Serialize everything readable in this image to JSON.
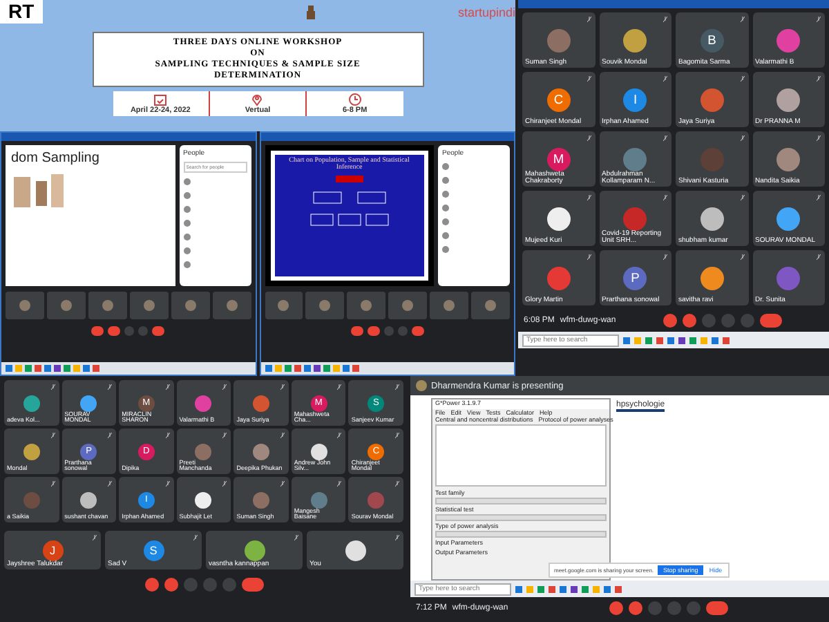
{
  "poster": {
    "logo": "RT",
    "brand": "startupindi",
    "title_lines": [
      "THREE DAYS ONLINE WORKSHOP",
      "ON",
      "SAMPLING TECHNIQUES & SAMPLE SIZE",
      "DETERMINATION"
    ],
    "info": [
      {
        "kind": "calendar",
        "text": "April 22-24, 2022"
      },
      {
        "kind": "pin",
        "text": "Vertual"
      },
      {
        "kind": "clock",
        "text": "6-8 PM"
      }
    ]
  },
  "left_window": {
    "slide_title": "dom Sampling",
    "people_title": "People",
    "search_placeholder": "Search for people"
  },
  "right_window": {
    "slide_title": "Chart on Population, Sample and Statistical Inference",
    "people_title": "People"
  },
  "top_grid": {
    "tiles": [
      {
        "name": "Suman Singh",
        "kind": "photo",
        "color": "#8d6e63"
      },
      {
        "name": "Souvik Mondal",
        "kind": "photo",
        "color": "#c0a040"
      },
      {
        "name": "Bagomita Sarma",
        "kind": "letter",
        "letter": "B",
        "color": "#455a64"
      },
      {
        "name": "Valarmathi B",
        "kind": "photo",
        "color": "#e040a0"
      },
      {
        "name": "Chiranjeet Mondal",
        "kind": "letter",
        "letter": "C",
        "color": "#ef6c00"
      },
      {
        "name": "Irphan Ahamed",
        "kind": "letter",
        "letter": "I",
        "color": "#1e88e5"
      },
      {
        "name": "Jaya Suriya",
        "kind": "photo",
        "color": "#d35430"
      },
      {
        "name": "Dr PRANNA M",
        "kind": "photo",
        "color": "#b0a0a0"
      },
      {
        "name": "Mahashweta Chakraborty",
        "kind": "letter",
        "letter": "M",
        "color": "#d81b60"
      },
      {
        "name": "Abdulrahman Kollamparam N...",
        "kind": "photo",
        "color": "#607d8b"
      },
      {
        "name": "Shivani Kasturia",
        "kind": "photo",
        "color": "#5d4037"
      },
      {
        "name": "Nandita Saikia",
        "kind": "photo",
        "color": "#a1887f"
      },
      {
        "name": "Mujeed Kuri",
        "kind": "photo",
        "color": "#eeeeee"
      },
      {
        "name": "Covid-19 Reporting Unit SRH...",
        "kind": "photo",
        "color": "#c62828"
      },
      {
        "name": "shubham kumar",
        "kind": "photo",
        "color": "#bdbdbd"
      },
      {
        "name": "SOURAV MONDAL",
        "kind": "photo",
        "color": "#42a5f5"
      },
      {
        "name": "Glory Martin",
        "kind": "photo",
        "color": "#e53935"
      },
      {
        "name": "Prarthana sonowal",
        "kind": "letter",
        "letter": "P",
        "color": "#5c6bc0"
      },
      {
        "name": "savitha ravi",
        "kind": "photo",
        "color": "#ef8a1f"
      },
      {
        "name": "Dr. Sunita",
        "kind": "photo",
        "color": "#7e57c2"
      }
    ],
    "time": "6:08 PM",
    "code": "wfm-duwg-wan",
    "search_placeholder": "Type here to search"
  },
  "bottom_grid": {
    "tiles": [
      {
        "name": "adeva Kol...",
        "kind": "photo",
        "color": "#26a69a"
      },
      {
        "name": "SOURAV MONDAL",
        "kind": "photo",
        "color": "#42a5f5"
      },
      {
        "name": "MIRACLIN SHARON",
        "kind": "letter",
        "letter": "M",
        "color": "#6d4c41"
      },
      {
        "name": "Valarmathi B",
        "kind": "photo",
        "color": "#e040a0"
      },
      {
        "name": "Jaya Suriya",
        "kind": "photo",
        "color": "#d35430"
      },
      {
        "name": "Mahashweta Cha...",
        "kind": "letter",
        "letter": "M",
        "color": "#d81b60"
      },
      {
        "name": "Sanjeev Kumar",
        "kind": "letter",
        "letter": "S",
        "color": "#00897b"
      },
      {
        "name": "Mondal",
        "kind": "photo",
        "color": "#c0a040"
      },
      {
        "name": "Prarthana sonowal",
        "kind": "letter",
        "letter": "P",
        "color": "#5c6bc0"
      },
      {
        "name": "Dipika",
        "kind": "letter",
        "letter": "D",
        "color": "#d81b60"
      },
      {
        "name": "Preeti Manchanda",
        "kind": "photo",
        "color": "#8d6e63"
      },
      {
        "name": "Deepika Phukan",
        "kind": "photo",
        "color": "#a1887f"
      },
      {
        "name": "Andrew John Silv...",
        "kind": "photo",
        "color": "#e0e0e0"
      },
      {
        "name": "Chiranjeet Mondal",
        "kind": "letter",
        "letter": "C",
        "color": "#ef6c00"
      },
      {
        "name": "a Saikia",
        "kind": "photo",
        "color": "#6d4c41"
      },
      {
        "name": "sushant chavan",
        "kind": "photo",
        "color": "#bdbdbd"
      },
      {
        "name": "Irphan Ahamed",
        "kind": "letter",
        "letter": "I",
        "color": "#1e88e5"
      },
      {
        "name": "Subhajit Let",
        "kind": "photo",
        "color": "#eeeeee"
      },
      {
        "name": "Suman Singh",
        "kind": "photo",
        "color": "#8d6e63"
      },
      {
        "name": "Mangesh Baisane",
        "kind": "photo",
        "color": "#607d8b"
      },
      {
        "name": "Sourav Mondal",
        "kind": "photo",
        "color": "#a1484f"
      }
    ],
    "large_tiles": [
      {
        "name": "Jayshree Talukdar",
        "kind": "letter",
        "letter": "J",
        "color": "#d84315"
      },
      {
        "name": "Sad V",
        "kind": "letter",
        "letter": "S",
        "color": "#1e88e5"
      },
      {
        "name": "vasntha kannappan",
        "kind": "photo",
        "color": "#7cb342"
      },
      {
        "name": "You",
        "kind": "photo",
        "color": "#e0e0e0"
      }
    ]
  },
  "presenting": {
    "banner": "Dharmendra Kumar is presenting",
    "app_title": "G*Power 3.1.9.7",
    "menus": [
      "File",
      "Edit",
      "View",
      "Tests",
      "Calculator",
      "Help"
    ],
    "tabs": [
      "Central and noncentral distributions",
      "Protocol of power analyses"
    ],
    "labels": [
      "Test family",
      "Statistical test",
      "Type of power analysis",
      "Input Parameters",
      "Output Parameters"
    ],
    "page_heading": "hpsychologie",
    "share_notice": "meet.google.com is sharing your screen.",
    "stop_button": "Stop sharing",
    "hide_button": "Hide",
    "search_placeholder": "Type here to search",
    "time": "7:12 PM",
    "code": "wfm-duwg-wan"
  }
}
